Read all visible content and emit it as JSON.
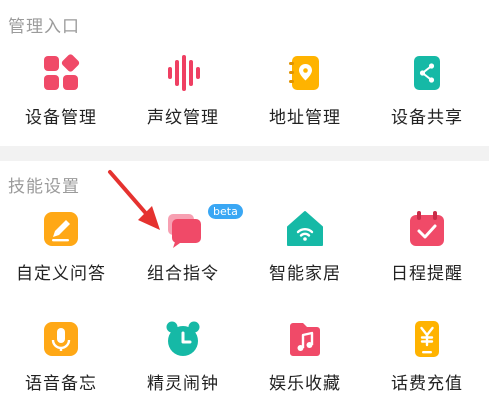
{
  "sections": {
    "manage": {
      "title": "管理入口",
      "items": [
        {
          "label": "设备管理",
          "icon": "device-grid-icon",
          "color": "#f04a68"
        },
        {
          "label": "声纹管理",
          "icon": "voiceprint-icon",
          "color": "#ef3f62"
        },
        {
          "label": "地址管理",
          "icon": "address-book-icon",
          "color": "#ffb300"
        },
        {
          "label": "设备共享",
          "icon": "share-icon",
          "color": "#16b9a6"
        }
      ]
    },
    "skills": {
      "title": "技能设置",
      "items": [
        {
          "label": "自定义问答",
          "icon": "edit-icon",
          "color": "#ffa816"
        },
        {
          "label": "组合指令",
          "icon": "chat-bubbles-icon",
          "color": "#f04a68",
          "badge": "beta"
        },
        {
          "label": "智能家居",
          "icon": "smart-home-icon",
          "color": "#16b9a6"
        },
        {
          "label": "日程提醒",
          "icon": "calendar-check-icon",
          "color": "#f04a68"
        },
        {
          "label": "语音备忘",
          "icon": "microphone-icon",
          "color": "#ffa816"
        },
        {
          "label": "精灵闹钟",
          "icon": "alarm-clock-icon",
          "color": "#16b9a6"
        },
        {
          "label": "娱乐收藏",
          "icon": "music-note-icon",
          "color": "#f04a68"
        },
        {
          "label": "话费充值",
          "icon": "phone-recharge-icon",
          "color": "#ffb300"
        }
      ]
    }
  },
  "annotation": {
    "color": "#e5322f"
  }
}
